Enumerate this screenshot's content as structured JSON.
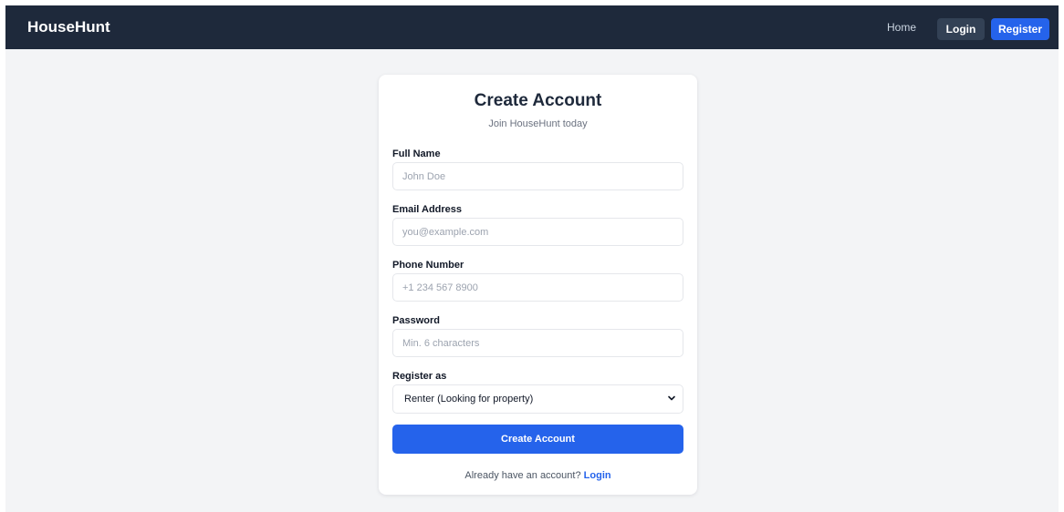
{
  "navbar": {
    "brand": "HouseHunt",
    "home": "Home",
    "login": "Login",
    "register": "Register"
  },
  "form": {
    "title": "Create Account",
    "subtitle": "Join HouseHunt today",
    "fields": [
      {
        "label": "Full Name",
        "placeholder": "John Doe",
        "value": ""
      },
      {
        "label": "Email Address",
        "placeholder": "you@example.com",
        "value": ""
      },
      {
        "label": "Phone Number",
        "placeholder": "+1 234 567 8900",
        "value": ""
      },
      {
        "label": "Password",
        "placeholder": "Min. 6 characters",
        "value": ""
      }
    ],
    "role": {
      "label": "Register as",
      "selected": "Renter (Looking for property)",
      "icon": "chevron-down-icon"
    },
    "submit": "Create Account",
    "footer_prompt": "Already have an account?",
    "footer_link": "Login"
  },
  "colors": {
    "navbar_bg": "#1e293b",
    "page_bg": "#f3f4f6",
    "accent": "#2563eb",
    "nav_login_bg": "#334155"
  }
}
